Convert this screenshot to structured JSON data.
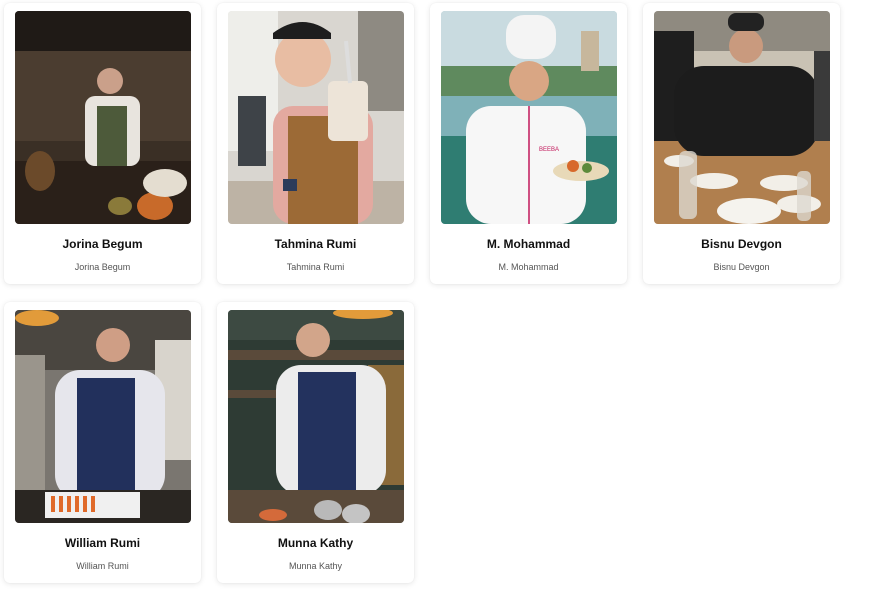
{
  "team": {
    "members": [
      {
        "name": "Jorina Begum",
        "subtitle": "Jorina Begum"
      },
      {
        "name": "Tahmina Rumi",
        "subtitle": "Tahmina Rumi"
      },
      {
        "name": "M. Mohammad",
        "subtitle": "M. Mohammad"
      },
      {
        "name": "Bisnu Devgon",
        "subtitle": "Bisnu Devgon"
      },
      {
        "name": "William Rumi",
        "subtitle": "William Rumi"
      },
      {
        "name": "Munna Kathy",
        "subtitle": "Munna Kathy"
      }
    ],
    "photo_badge_text": "BEEBA"
  }
}
